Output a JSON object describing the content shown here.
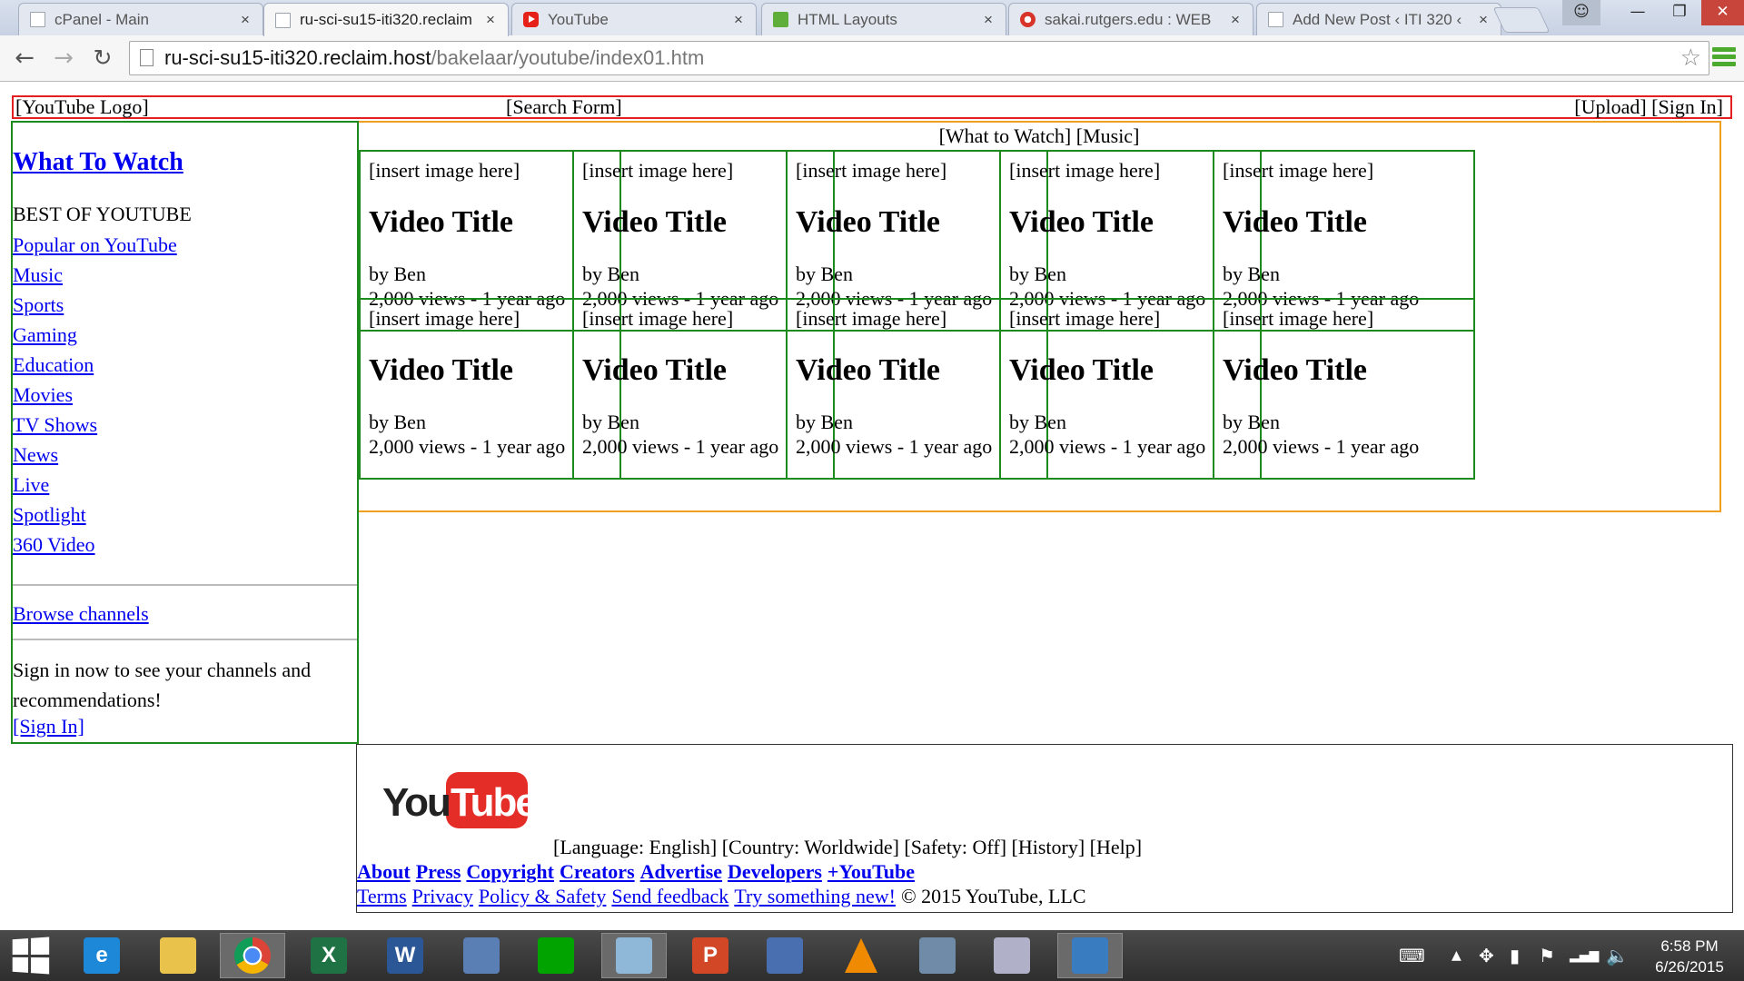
{
  "browser": {
    "tabs": [
      {
        "title": "cPanel - Main",
        "favicon": "document-icon",
        "active": false
      },
      {
        "title": "ru-sci-su15-iti320.reclaim",
        "favicon": "document-icon",
        "active": true
      },
      {
        "title": "YouTube",
        "favicon": "youtube-icon",
        "active": false
      },
      {
        "title": "HTML Layouts",
        "favicon": "w3schools-icon",
        "active": false
      },
      {
        "title": "sakai.rutgers.edu : WEB",
        "favicon": "sakai-icon",
        "active": false
      },
      {
        "title": "Add New Post ‹ ITI 320 ‹",
        "favicon": "document-icon",
        "active": false
      }
    ],
    "url_host": "ru-sci-su15-iti320.reclaim.host",
    "url_path": "/bakelaar/youtube/index01.htm",
    "back_glyph": "←",
    "forward_glyph": "→",
    "reload_glyph": "↻",
    "star_glyph": "☆",
    "tab_close_glyph": "×",
    "window": {
      "minimize": "—",
      "maximize": "❐",
      "close": "✕"
    }
  },
  "page": {
    "header": {
      "logo": "[YouTube Logo]",
      "search": "[Search Form]",
      "right": "[Upload] [Sign In]"
    },
    "sidebar": {
      "what_to_watch": "What To Watch",
      "best_of": "BEST OF YOUTUBE",
      "items": [
        "Popular on YouTube",
        "Music",
        "Sports",
        "Gaming",
        "Education",
        "Movies",
        "TV Shows",
        "News",
        "Live",
        "Spotlight",
        "360 Video"
      ],
      "browse_channels": "Browse channels",
      "signin_text": "Sign in now to see your channels and recommendations!",
      "signin_link": "[Sign In]"
    },
    "main": {
      "categories": "[What to Watch] [Music]",
      "videos": [
        {
          "image": "[insert image here]",
          "title": "Video Title",
          "by": "by Ben",
          "meta": "2,000 views - 1 year ago"
        },
        {
          "image": "[insert image here]",
          "title": "Video Title",
          "by": "by Ben",
          "meta": "2,000 views - 1 year ago"
        },
        {
          "image": "[insert image here]",
          "title": "Video Title",
          "by": "by Ben",
          "meta": "2,000 views - 1 year ago"
        },
        {
          "image": "[insert image here]",
          "title": "Video Title",
          "by": "by Ben",
          "meta": "2,000 views - 1 year ago"
        },
        {
          "image": "[insert image here]",
          "title": "Video Title",
          "by": "by Ben",
          "meta": "2,000 views - 1 year ago"
        },
        {
          "image": "[insert image here]",
          "title": "Video Title",
          "by": "by Ben",
          "meta": "2,000 views - 1 year ago"
        },
        {
          "image": "[insert image here]",
          "title": "Video Title",
          "by": "by Ben",
          "meta": "2,000 views - 1 year ago"
        },
        {
          "image": "[insert image here]",
          "title": "Video Title",
          "by": "by Ben",
          "meta": "2,000 views - 1 year ago"
        },
        {
          "image": "[insert image here]",
          "title": "Video Title",
          "by": "by Ben",
          "meta": "2,000 views - 1 year ago"
        },
        {
          "image": "[insert image here]",
          "title": "Video Title",
          "by": "by Ben",
          "meta": "2,000 views - 1 year ago"
        }
      ]
    },
    "footer": {
      "logo_you": "You",
      "logo_tube": "Tube",
      "options": "[Language: English] [Country: Worldwide] [Safety: Off] [History] [Help]",
      "links_primary": [
        "About",
        "Press",
        "Copyright",
        "Creators",
        "Advertise",
        "Developers",
        "+YouTube"
      ],
      "links_secondary": [
        "Terms",
        "Privacy",
        "Policy & Safety",
        "Send feedback",
        "Try something new!"
      ],
      "copyright": "© 2015 YouTube, LLC"
    }
  },
  "taskbar": {
    "apps": [
      {
        "name": "internet-explorer-icon",
        "label": "e",
        "color": "#1e88d8"
      },
      {
        "name": "file-explorer-icon",
        "label": "",
        "color": "#e8c24a"
      },
      {
        "name": "chrome-icon",
        "label": "",
        "color": "#dd4b39",
        "active": true
      },
      {
        "name": "excel-icon",
        "label": "X",
        "color": "#1f7244"
      },
      {
        "name": "word-icon",
        "label": "W",
        "color": "#2b5797"
      },
      {
        "name": "remote-desktop-icon",
        "label": "",
        "color": "#5a7fb5"
      },
      {
        "name": "store-icon",
        "label": "",
        "color": "#00a300"
      },
      {
        "name": "notepad-icon",
        "label": "",
        "color": "#8fb7d8",
        "active": true
      },
      {
        "name": "powerpoint-icon",
        "label": "P",
        "color": "#d24726"
      },
      {
        "name": "network-icon",
        "label": "",
        "color": "#4a6fb0"
      },
      {
        "name": "vlc-icon",
        "label": "",
        "color": "#f08a00"
      },
      {
        "name": "calculator-icon",
        "label": "",
        "color": "#6f8ba8"
      },
      {
        "name": "paint-icon",
        "label": "",
        "color": "#b0b0c8"
      },
      {
        "name": "vpn-icon",
        "label": "",
        "color": "#3a7cc0",
        "active": true
      }
    ],
    "tray_glyphs": {
      "keyboard": "⌨",
      "chevron": "▲",
      "dropbox": "✥",
      "power": "▮",
      "flag": "⚑",
      "signal": "▂▄▆",
      "volume": "🔈"
    },
    "time": "6:58 PM",
    "date": "6/26/2015"
  },
  "colors": {
    "header_border": "#e31f1f",
    "sidebar_border": "#1c8a1c",
    "main_border": "#f0a020",
    "card_border": "#1c8a1c",
    "link": "#0000ee"
  }
}
